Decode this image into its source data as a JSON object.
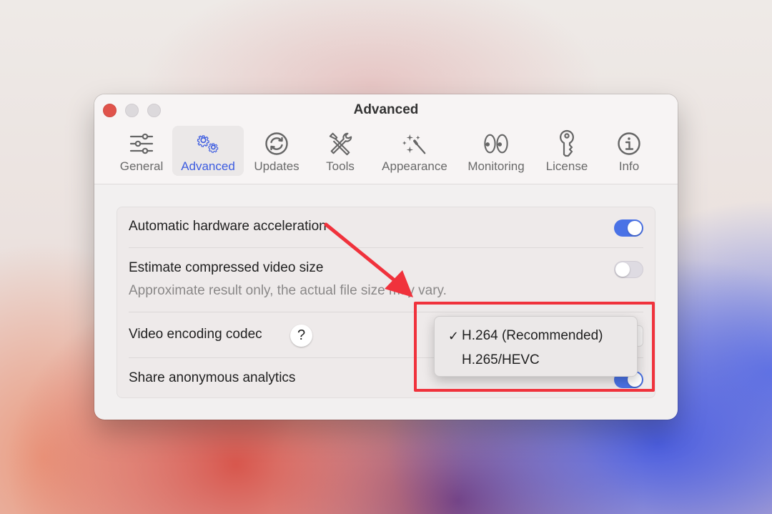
{
  "window": {
    "title": "Advanced",
    "traffic_lights": [
      "close",
      "minimize",
      "zoom"
    ]
  },
  "tabs": [
    {
      "label": "General",
      "icon": "sliders-icon",
      "active": false
    },
    {
      "label": "Advanced",
      "icon": "gears-icon",
      "active": true
    },
    {
      "label": "Updates",
      "icon": "refresh-icon",
      "active": false
    },
    {
      "label": "Tools",
      "icon": "tools-icon",
      "active": false
    },
    {
      "label": "Appearance",
      "icon": "magic-wand-icon",
      "active": false
    },
    {
      "label": "Monitoring",
      "icon": "eyes-icon",
      "active": false
    },
    {
      "label": "License",
      "icon": "key-icon",
      "active": false
    },
    {
      "label": "Info",
      "icon": "info-icon",
      "active": false
    }
  ],
  "settings": {
    "hardware_acceleration": {
      "label": "Automatic hardware acceleration",
      "enabled": true
    },
    "estimate_size": {
      "label": "Estimate compressed video size",
      "description": "Approximate result only, the actual file size may vary.",
      "enabled": false
    },
    "codec": {
      "label": "Video encoding codec",
      "help": "?",
      "selected": "H.264 (Recommended)"
    },
    "analytics": {
      "label": "Share anonymous analytics",
      "enabled": true
    }
  },
  "codec_menu": {
    "options": [
      {
        "label": "H.264 (Recommended)",
        "checked": true,
        "check_glyph": "✓"
      },
      {
        "label": "H.265/HEVC",
        "checked": false,
        "check_glyph": ""
      }
    ]
  },
  "annotation": {
    "highlight_color": "#f0323c",
    "arrow_color": "#f0323c"
  },
  "colors": {
    "accent": "#3d5ce0",
    "toggle_on": "#4a72e6",
    "close_button": "#e0534b"
  }
}
